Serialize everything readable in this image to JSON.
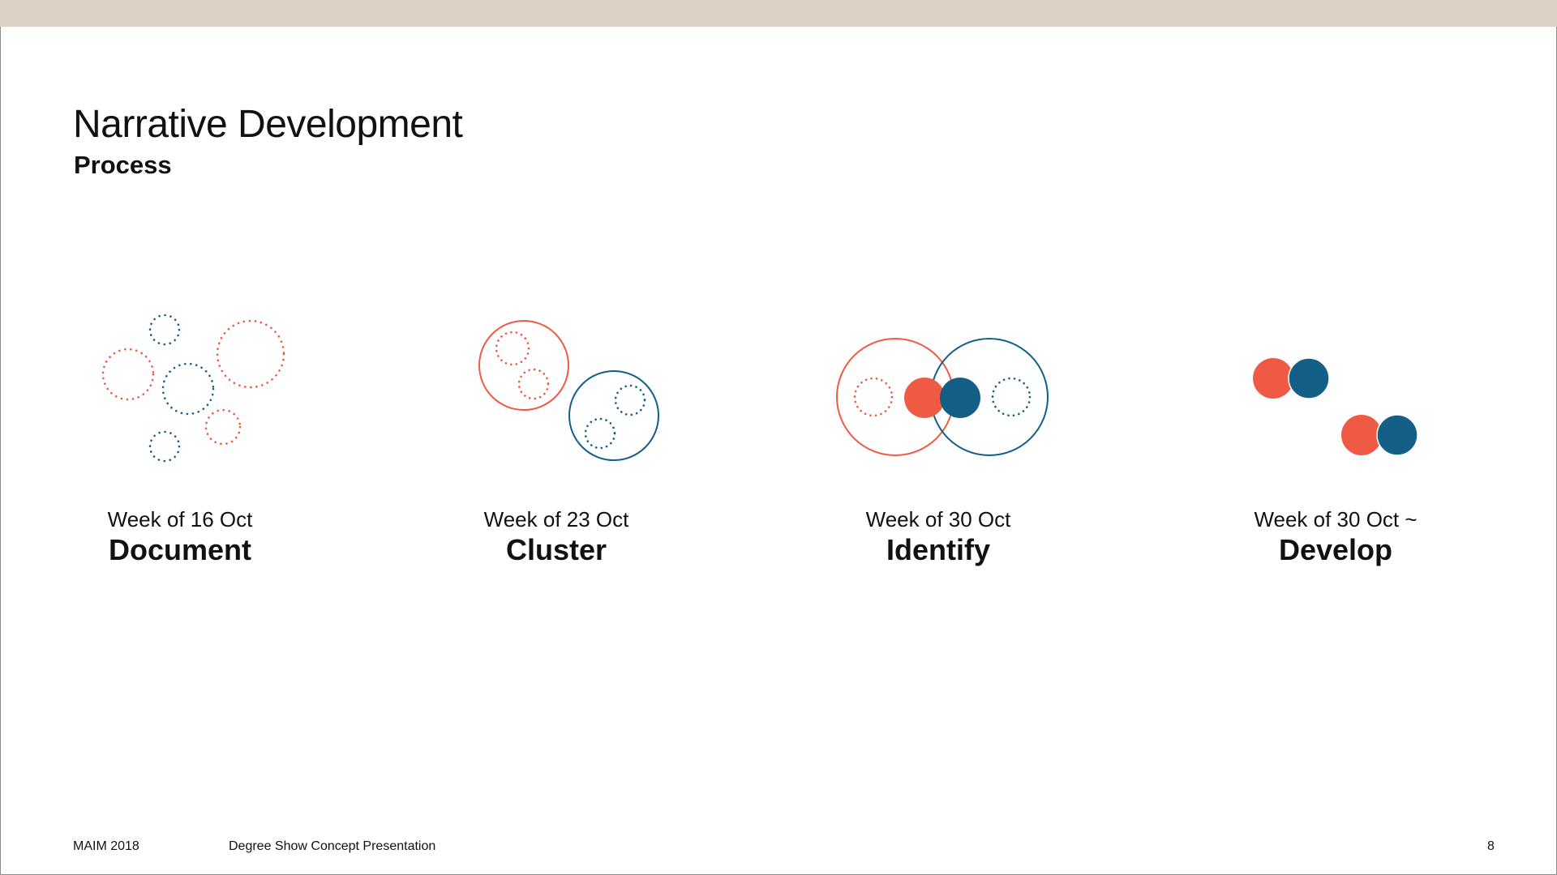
{
  "slide": {
    "title": "Narrative Development",
    "subtitle": "Process"
  },
  "colors": {
    "band": "#ddd0c5",
    "red": "#ef5a45",
    "blue": "#135f86"
  },
  "steps": [
    {
      "date": "Week of 16 Oct",
      "name": "Document"
    },
    {
      "date": "Week of 23 Oct",
      "name": "Cluster"
    },
    {
      "date": "Week of 30 Oct",
      "name": "Identify"
    },
    {
      "date": "Week of 30 Oct ~",
      "name": "Develop"
    }
  ],
  "footer": {
    "left": "MAIM 2018",
    "center": "Degree Show Concept Presentation",
    "page_number": "8"
  }
}
